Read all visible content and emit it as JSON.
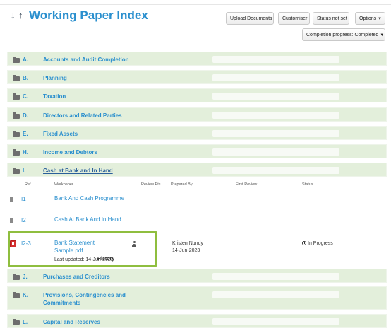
{
  "header": {
    "title": "Working Paper Index",
    "buttons": {
      "upload": "Upload Documents",
      "customiser": "Customiser",
      "status": "Status not set",
      "options": "Options",
      "completion": "Completion progress: Completed"
    }
  },
  "sections": [
    {
      "letter": "A.",
      "title": "Accounts and Audit Completion"
    },
    {
      "letter": "B.",
      "title": "Planning"
    },
    {
      "letter": "C.",
      "title": "Taxation"
    },
    {
      "letter": "D.",
      "title": "Directors and Related Parties"
    },
    {
      "letter": "E.",
      "title": "Fixed Assets"
    },
    {
      "letter": "H.",
      "title": "Income and Debtors"
    },
    {
      "letter": "I.",
      "title": "Cash at Bank and In Hand"
    },
    {
      "letter": "J.",
      "title": "Purchases and Creditors"
    },
    {
      "letter": "K.",
      "title": "Provisions, Contingencies and Commitments"
    },
    {
      "letter": "L.",
      "title": "Capital and Reserves"
    }
  ],
  "columns": {
    "ref": "Ref",
    "workpaper": "Workpaper",
    "review_pts": "Review Pts",
    "prepared_by": "Prepared By",
    "first_review": "First Review",
    "status": "Status"
  },
  "rows": [
    {
      "ref": "I1",
      "name": "Bank And Cash Programme"
    },
    {
      "ref": "I2",
      "name": "Cash At Bank And In Hand"
    },
    {
      "ref": "I2-3",
      "name_line1": "Bank Statement",
      "name_line2": "Sample.pdf",
      "last_updated": "Last updated: 14-Jun-2023",
      "history": "History",
      "prepared_by": "Kristen Nundy",
      "prepared_date": "14-Jun-2023",
      "status": "In Progress"
    }
  ],
  "colors": {
    "accent": "#2a8fce",
    "section_bg": "#e3efdb",
    "highlight": "#8fbe3f"
  }
}
